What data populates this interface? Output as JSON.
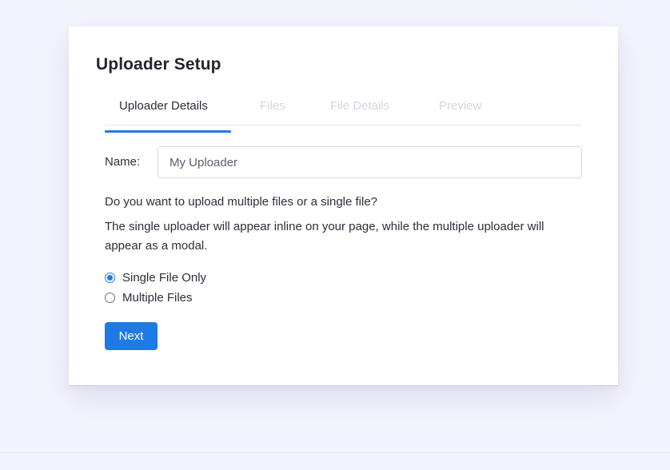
{
  "card": {
    "title": "Uploader Setup"
  },
  "tabs": [
    {
      "label": "Uploader Details",
      "active": true
    },
    {
      "label": "Files",
      "active": false
    },
    {
      "label": "File Details",
      "active": false
    },
    {
      "label": "Preview",
      "active": false
    }
  ],
  "form": {
    "name_label": "Name:",
    "name_value": "My Uploader",
    "question": "Do you want to upload multiple files or a single file?",
    "description": "The single uploader will appear inline on your page, while the multiple uploader will appear as a modal.",
    "options": [
      {
        "label": "Single File Only",
        "selected": true
      },
      {
        "label": "Multiple Files",
        "selected": false
      }
    ],
    "next_label": "Next"
  },
  "colors": {
    "accent": "#1f7ae6",
    "background": "#f3f4fb",
    "inactive_tab": "#d3d5e0"
  }
}
